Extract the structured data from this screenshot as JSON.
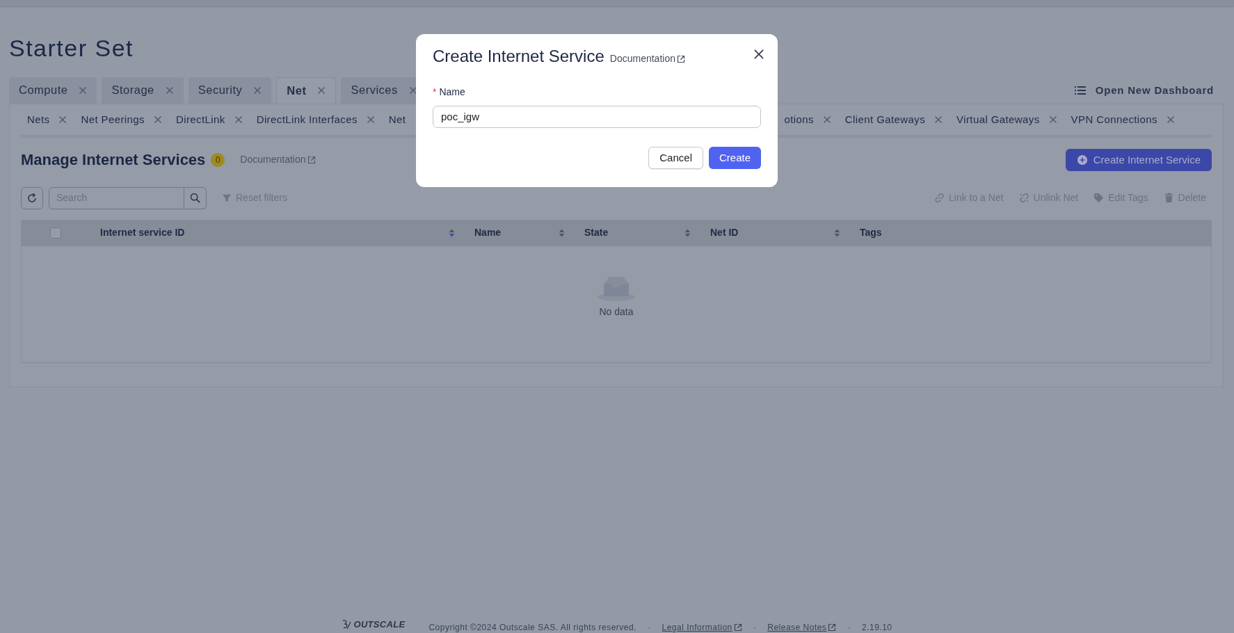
{
  "page_title": "Starter Set",
  "main_tabs": [
    {
      "label": "Compute",
      "selected": false
    },
    {
      "label": "Storage",
      "selected": false
    },
    {
      "label": "Security",
      "selected": false
    },
    {
      "label": "Net",
      "selected": true
    },
    {
      "label": "Services",
      "selected": false
    }
  ],
  "open_dashboard": "Open New Dashboard",
  "sub_tabs_left": [
    {
      "label": "Nets",
      "close_visible": true
    },
    {
      "label": "Net Peerings",
      "close_visible": true
    },
    {
      "label": "DirectLink",
      "close_visible": true
    },
    {
      "label": "DirectLink Interfaces",
      "close_visible": true
    },
    {
      "label": "Net",
      "close_visible": false
    }
  ],
  "sub_tabs_right": [
    {
      "label": "otions",
      "close_visible": true
    },
    {
      "label": "Client Gateways",
      "close_visible": true
    },
    {
      "label": "Virtual Gateways",
      "close_visible": true
    },
    {
      "label": "VPN Connections",
      "close_visible": true
    }
  ],
  "section": {
    "title": "Manage Internet Services",
    "count": "0",
    "doc_link": "Documentation",
    "create_button": "Create Internet Service"
  },
  "toolbar": {
    "placeholder": "Search",
    "reset_filters": "Reset filters",
    "actions": [
      {
        "label": "Link to a Net",
        "kind": "link",
        "disabled": true
      },
      {
        "label": "Unlink Net",
        "kind": "unlink",
        "disabled": true
      },
      {
        "label": "Edit Tags",
        "kind": "tag",
        "disabled": true
      },
      {
        "label": "Delete",
        "kind": "delete",
        "disabled": true
      }
    ]
  },
  "table": {
    "select_all_checked": false,
    "columns": [
      {
        "label": "Internet service ID",
        "sortable": true,
        "sorted_desc": true
      },
      {
        "label": "Name",
        "sortable": true,
        "sorted_desc": false
      },
      {
        "label": "State",
        "sortable": true,
        "sorted_desc": false
      },
      {
        "label": "Net ID",
        "sortable": true,
        "sorted_desc": false
      },
      {
        "label": "Tags",
        "sortable": false
      }
    ],
    "empty_text": "No data"
  },
  "modal": {
    "title": "Create Internet Service",
    "doc_link": "Documentation",
    "fields": [
      {
        "label": "Name",
        "required_mark": "*",
        "value": "poc_igw"
      }
    ],
    "buttons": [
      {
        "label": "Cancel",
        "kind": "secondary"
      },
      {
        "label": "Create",
        "kind": "primary"
      }
    ]
  },
  "footer": {
    "brand": "OUTSCALE",
    "items": [
      {
        "kind": "text",
        "text": "Copyright ©2024 Outscale SAS. All rights reserved."
      },
      {
        "kind": "sep",
        "text": "·"
      },
      {
        "kind": "link",
        "text": "Legal Information"
      },
      {
        "kind": "sep",
        "text": "·"
      },
      {
        "kind": "link",
        "text": "Release Notes"
      },
      {
        "kind": "sep",
        "text": "·"
      },
      {
        "kind": "text",
        "text": "2.19.10"
      }
    ]
  }
}
